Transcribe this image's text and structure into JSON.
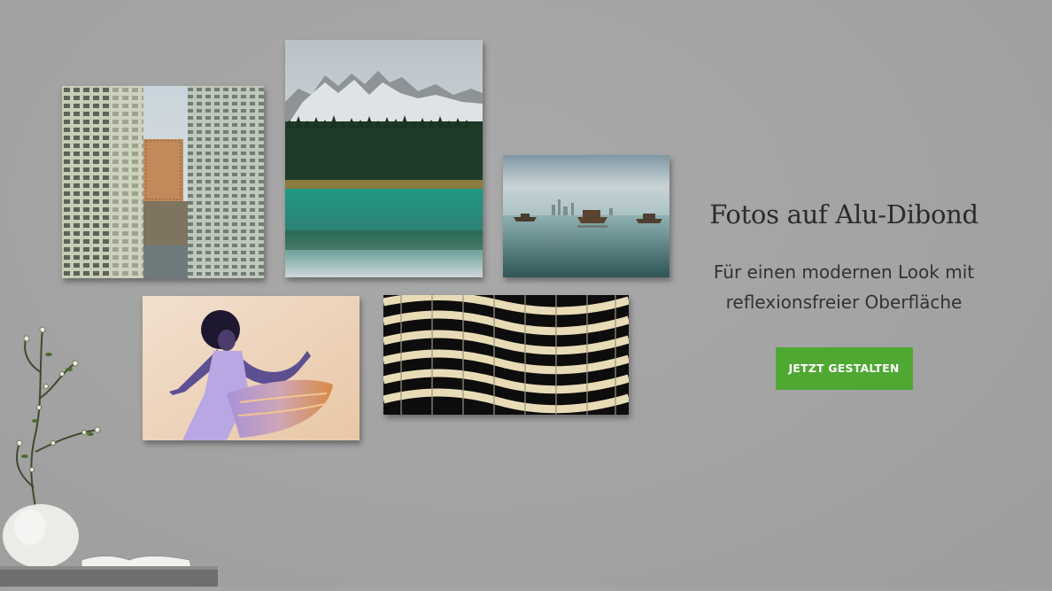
{
  "hero": {
    "headline": "Fotos auf Alu-Dibond",
    "subline_line1": "Für einen modernen Look mit",
    "subline_line2": "reflexionsfreier Oberfläche",
    "cta_label": "JETZT GESTALTEN"
  },
  "colors": {
    "background": "#a4a4a4",
    "cta_background": "#4ea832",
    "cta_text": "#ffffff",
    "headline_text": "#2b2b2b"
  },
  "gallery": [
    {
      "name": "photo-city-apartment-blocks"
    },
    {
      "name": "photo-mountain-lake-reflection"
    },
    {
      "name": "photo-harbor-skyline-boats"
    },
    {
      "name": "photo-dancer-flowing-dress"
    },
    {
      "name": "photo-wavy-architecture"
    }
  ]
}
